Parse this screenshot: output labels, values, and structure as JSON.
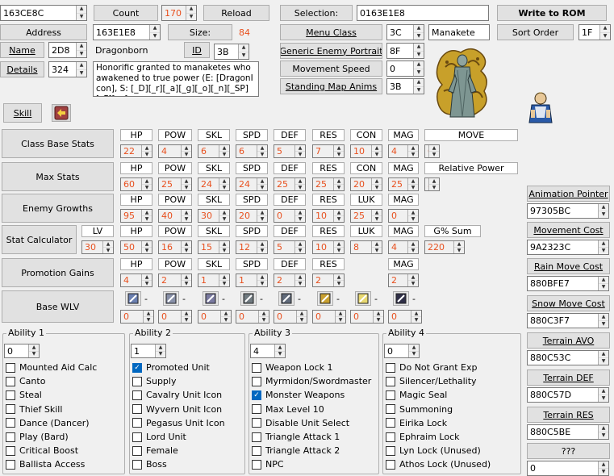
{
  "top": {
    "address_value": "163CE8C",
    "count_label": "Count",
    "count_value": "170",
    "reload_label": "Reload",
    "selection_label": "Selection:",
    "selection_value": "0163E1E8",
    "write_rom_label": "Write to ROM",
    "address_label": "Address",
    "address_field": "163E1E8",
    "size_label": "Size:",
    "size_value": "84",
    "menu_class_label": "Menu Class",
    "menu_class_value": "3C",
    "menu_class_name": "Manakete",
    "sort_order_label": "Sort Order",
    "sort_order_value": "1F",
    "name_label": "Name",
    "name_value": "2D8",
    "name_text": "Dragonborn",
    "id_label": "ID",
    "id_value": "3B",
    "generic_portrait_label": "Generic Enemy Portrait",
    "generic_portrait_value": "8F",
    "details_label": "Details",
    "details_value": "324",
    "details_text": "Honorific granted to manaketes who awakened to true power (E: [DragonIcon], S: [_D][_r][_a][_g][_o][_n][_SP][_F][_a]",
    "movement_speed_label": "Movement Speed",
    "movement_speed_value": "0",
    "standing_map_label": "Standing Map Anims",
    "standing_map_value": "3B",
    "skill_label": "Skill"
  },
  "stats": {
    "base": {
      "label": "Class Base Stats",
      "headers": [
        "HP",
        "POW",
        "SKL",
        "SPD",
        "DEF",
        "RES",
        "CON",
        "MAG",
        "MOVE"
      ],
      "values": [
        "22",
        "4",
        "6",
        "6",
        "5",
        "7",
        "10",
        "4",
        "6"
      ]
    },
    "max": {
      "label": "Max Stats",
      "headers": [
        "HP",
        "POW",
        "SKL",
        "SPD",
        "DEF",
        "RES",
        "CON",
        "MAG",
        "Relative Power"
      ],
      "values": [
        "60",
        "25",
        "24",
        "24",
        "25",
        "25",
        "20",
        "25",
        "3"
      ]
    },
    "growth": {
      "label": "Enemy Growths",
      "headers": [
        "HP",
        "POW",
        "SKL",
        "SPD",
        "DEF",
        "RES",
        "LUK",
        "MAG"
      ],
      "values": [
        "95",
        "40",
        "30",
        "20",
        "0",
        "10",
        "25",
        "0"
      ]
    },
    "calc": {
      "label": "Stat Calculator",
      "lv_label": "LV",
      "lv_value": "30",
      "headers": [
        "HP",
        "POW",
        "SKL",
        "SPD",
        "DEF",
        "RES",
        "LUK",
        "MAG",
        "G% Sum"
      ],
      "values": [
        "50",
        "16",
        "15",
        "12",
        "5",
        "10",
        "8",
        "4",
        "220"
      ]
    },
    "promo": {
      "label": "Promotion Gains",
      "headers": [
        "HP",
        "POW",
        "SKL",
        "SPD",
        "DEF",
        "RES",
        "MAG"
      ],
      "values": [
        "4",
        "2",
        "1",
        "1",
        "2",
        "2",
        "2"
      ]
    },
    "wlv": {
      "label": "Base WLV",
      "dash": "-",
      "icons": [
        "sword-icon",
        "lance-icon",
        "axe-icon",
        "bow-icon",
        "staff-icon",
        "anima-icon",
        "light-icon",
        "dark-icon"
      ],
      "values": [
        "0",
        "0",
        "0",
        "0",
        "0",
        "0",
        "0",
        "0"
      ]
    }
  },
  "right_panel": {
    "animation_pointer_label": "Animation Pointer",
    "animation_pointer_value": "97305BC",
    "movement_cost_label": "Movement Cost",
    "movement_cost_value": "9A2323C",
    "rain_move_cost_label": "Rain Move Cost",
    "rain_move_cost_value": "880BFE7",
    "snow_move_cost_label": "Snow Move Cost",
    "snow_move_cost_value": "880C3F7",
    "terrain_avo_label": "Terrain AVO",
    "terrain_avo_value": "880C53C",
    "terrain_def_label": "Terrain DEF",
    "terrain_def_value": "880C57D",
    "terrain_res_label": "Terrain RES",
    "terrain_res_value": "880C5BE",
    "unknown_label": "???",
    "unknown_value": "0"
  },
  "abilities": [
    {
      "title": "Ability 1",
      "value": "0",
      "items": [
        {
          "label": "Mounted Aid Calc",
          "checked": false
        },
        {
          "label": "Canto",
          "checked": false
        },
        {
          "label": "Steal",
          "checked": false
        },
        {
          "label": "Thief Skill",
          "checked": false
        },
        {
          "label": "Dance (Dancer)",
          "checked": false
        },
        {
          "label": "Play (Bard)",
          "checked": false
        },
        {
          "label": "Critical Boost",
          "checked": false
        },
        {
          "label": "Ballista Access",
          "checked": false
        }
      ]
    },
    {
      "title": "Ability 2",
      "value": "1",
      "items": [
        {
          "label": "Promoted Unit",
          "checked": true
        },
        {
          "label": "Supply",
          "checked": false
        },
        {
          "label": "Cavalry Unit Icon",
          "checked": false
        },
        {
          "label": "Wyvern Unit Icon",
          "checked": false
        },
        {
          "label": "Pegasus Unit Icon",
          "checked": false
        },
        {
          "label": "Lord Unit",
          "checked": false
        },
        {
          "label": "Female",
          "checked": false
        },
        {
          "label": "Boss",
          "checked": false
        }
      ]
    },
    {
      "title": "Ability 3",
      "value": "4",
      "items": [
        {
          "label": "Weapon Lock 1",
          "checked": false
        },
        {
          "label": "Myrmidon/Swordmaster",
          "checked": false
        },
        {
          "label": "Monster Weapons",
          "checked": true
        },
        {
          "label": "Max Level 10",
          "checked": false
        },
        {
          "label": "Disable Unit Select",
          "checked": false
        },
        {
          "label": "Triangle Attack 1",
          "checked": false
        },
        {
          "label": "Triangle Attack 2",
          "checked": false
        },
        {
          "label": "NPC",
          "checked": false
        }
      ]
    },
    {
      "title": "Ability 4",
      "value": "0",
      "items": [
        {
          "label": "Do Not Grant Exp",
          "checked": false
        },
        {
          "label": "Silencer/Lethality",
          "checked": false
        },
        {
          "label": "Magic Seal",
          "checked": false
        },
        {
          "label": "Summoning",
          "checked": false
        },
        {
          "label": "Eirika Lock",
          "checked": false
        },
        {
          "label": "Ephraim Lock",
          "checked": false
        },
        {
          "label": "Lyn Lock (Unused)",
          "checked": false
        },
        {
          "label": "Athos Lock (Unused)",
          "checked": false
        }
      ]
    }
  ],
  "colors": {
    "accent_value": "#e8501e",
    "checkbox_on": "#0067c0",
    "portrait_gold": "#c8a02a",
    "portrait_bg": "#8aa8c8"
  },
  "icons": {
    "portrait": "dragon-portrait-icon",
    "map_sprite": "map-sprite-icon",
    "skill": "skill-icon"
  }
}
